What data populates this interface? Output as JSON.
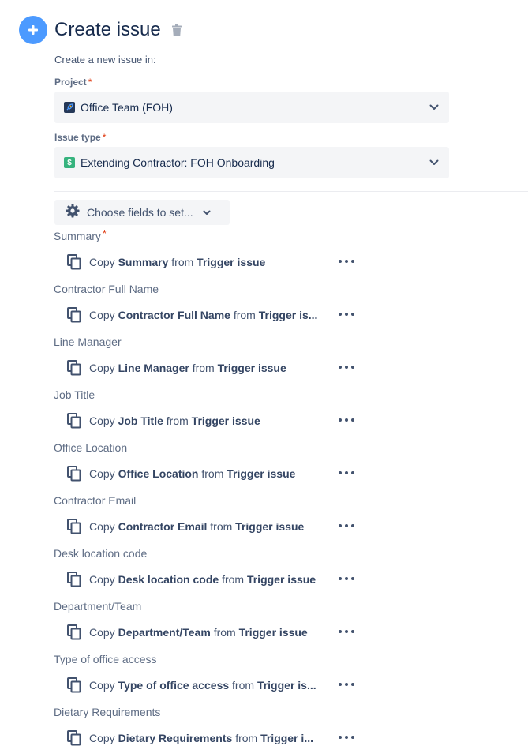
{
  "header": {
    "title": "Create issue",
    "subtitle": "Create a new issue in:"
  },
  "project": {
    "label": "Project",
    "required": "*",
    "value": "Office Team (FOH)"
  },
  "issue_type": {
    "label": "Issue type",
    "required": "*",
    "value": "Extending Contractor: FOH Onboarding",
    "icon_glyph": "$"
  },
  "choose_fields": {
    "label": "Choose fields to set..."
  },
  "fields": [
    {
      "label": "Summary",
      "required": "*",
      "copy": "Copy",
      "field": "Summary",
      "from": "from",
      "source": "Trigger issue"
    },
    {
      "label": "Contractor Full Name",
      "required": "",
      "copy": "Copy",
      "field": "Contractor Full Name",
      "from": "from",
      "source": "Trigger is..."
    },
    {
      "label": "Line Manager",
      "required": "",
      "copy": "Copy",
      "field": "Line Manager",
      "from": "from",
      "source": "Trigger issue"
    },
    {
      "label": "Job Title",
      "required": "",
      "copy": "Copy",
      "field": "Job Title",
      "from": "from",
      "source": "Trigger issue"
    },
    {
      "label": "Office Location",
      "required": "",
      "copy": "Copy",
      "field": "Office Location",
      "from": "from",
      "source": "Trigger issue"
    },
    {
      "label": "Contractor Email",
      "required": "",
      "copy": "Copy",
      "field": "Contractor Email",
      "from": "from",
      "source": "Trigger issue"
    },
    {
      "label": "Desk location code",
      "required": "",
      "copy": "Copy",
      "field": "Desk location code",
      "from": "from",
      "source": "Trigger issue"
    },
    {
      "label": "Department/Team",
      "required": "",
      "copy": "Copy",
      "field": "Department/Team",
      "from": "from",
      "source": "Trigger issue"
    },
    {
      "label": "Type of office access",
      "required": "",
      "copy": "Copy",
      "field": "Type of office access",
      "from": "from",
      "source": "Trigger is..."
    },
    {
      "label": "Dietary Requirements",
      "required": "",
      "copy": "Copy",
      "field": "Dietary Requirements",
      "from": "from",
      "source": "Trigger i..."
    }
  ]
}
